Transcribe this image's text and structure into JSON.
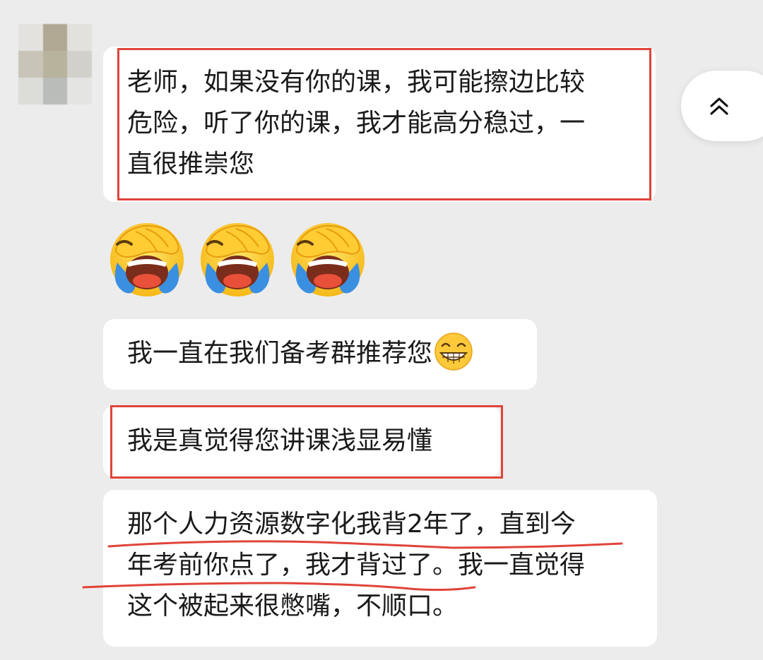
{
  "chat": {
    "messages": [
      {
        "id": "m1",
        "text": "老师，如果没有你的课，我可能擦边比较危险，听了你的课，我才能高分稳过，一直很推崇您",
        "lines": [
          "老师，如果没有你的课，我可能擦边比较",
          "危险，听了你的课，我才能高分稳过，一",
          "直很推崇您"
        ]
      },
      {
        "id": "m2",
        "emoji": "facepalm-crying-emoji"
      },
      {
        "id": "m3",
        "text": "我一直在我们备考群推荐您",
        "trailing_emoji": "grinning-face-emoji"
      },
      {
        "id": "m4",
        "text": "我是真觉得您讲课浅显易懂"
      },
      {
        "id": "m5",
        "lines": [
          "那个人力资源数字化我背2年了，直到今",
          "年考前你点了，我才背过了。我一直觉得",
          "这个被起来很憋嘴，不顺口。"
        ]
      }
    ]
  },
  "colors": {
    "background": "#ececec",
    "bubble": "#ffffff",
    "highlight_box": "#e0443a",
    "underline": "#e0443a"
  },
  "icons": {
    "scroll_top": "double-chevron-up-icon"
  }
}
